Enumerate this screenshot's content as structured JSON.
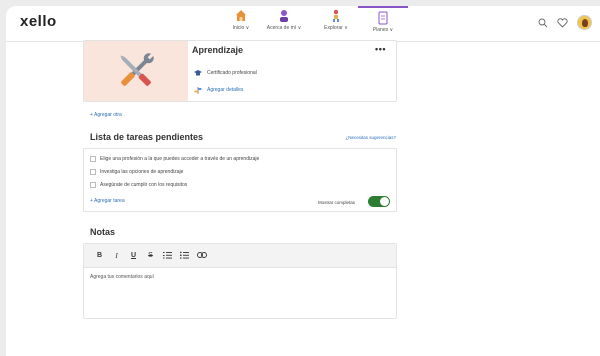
{
  "header": {
    "logo": "xello",
    "nav": [
      {
        "label": "Inicio ∨",
        "icon": "house-icon",
        "color": "#e8913a"
      },
      {
        "label": "Acerca de mí ∨",
        "icon": "person-icon",
        "color": "#8a55c9"
      },
      {
        "label": "Explorar ∨",
        "icon": "explore-person-icon",
        "color": "#d9534f"
      },
      {
        "label": "Planes ∨",
        "icon": "planner-icon",
        "color": "#8a55c9"
      }
    ],
    "right_icons": [
      "search-icon",
      "heart-icon",
      "avatar"
    ]
  },
  "card": {
    "title": "Aprendizaje",
    "more": "•••",
    "image_icon": "tools-icon",
    "certificate": "Certificado profesional",
    "add_details": "Agregar detalles"
  },
  "add_other": "+ Agregar otra",
  "tasks": {
    "title": "Lista de tareas pendientes",
    "suggestions_link": "¿Necesitas sugerencias?",
    "items": [
      "Elige una profesión a la que puedes acceder a través de un aprendizaje",
      "Investiga las opciones de aprendizaje",
      "Asegúrate de cumplir con los requisitos"
    ],
    "add_task": "+ Agregar tarea",
    "show_completed": "Mostrar completas",
    "show_completed_on": true
  },
  "notes": {
    "title": "Notas",
    "toolbar": [
      "B",
      "I",
      "U",
      "S",
      "ordered-list-icon",
      "bullet-list-icon",
      "link-icon"
    ],
    "placeholder": "Agrega tus comentarios aquí"
  },
  "colors": {
    "accent": "#8a55c9",
    "link": "#2f6fb8",
    "toggle": "#2e7d32",
    "card_bg": "#f9e5dc"
  }
}
